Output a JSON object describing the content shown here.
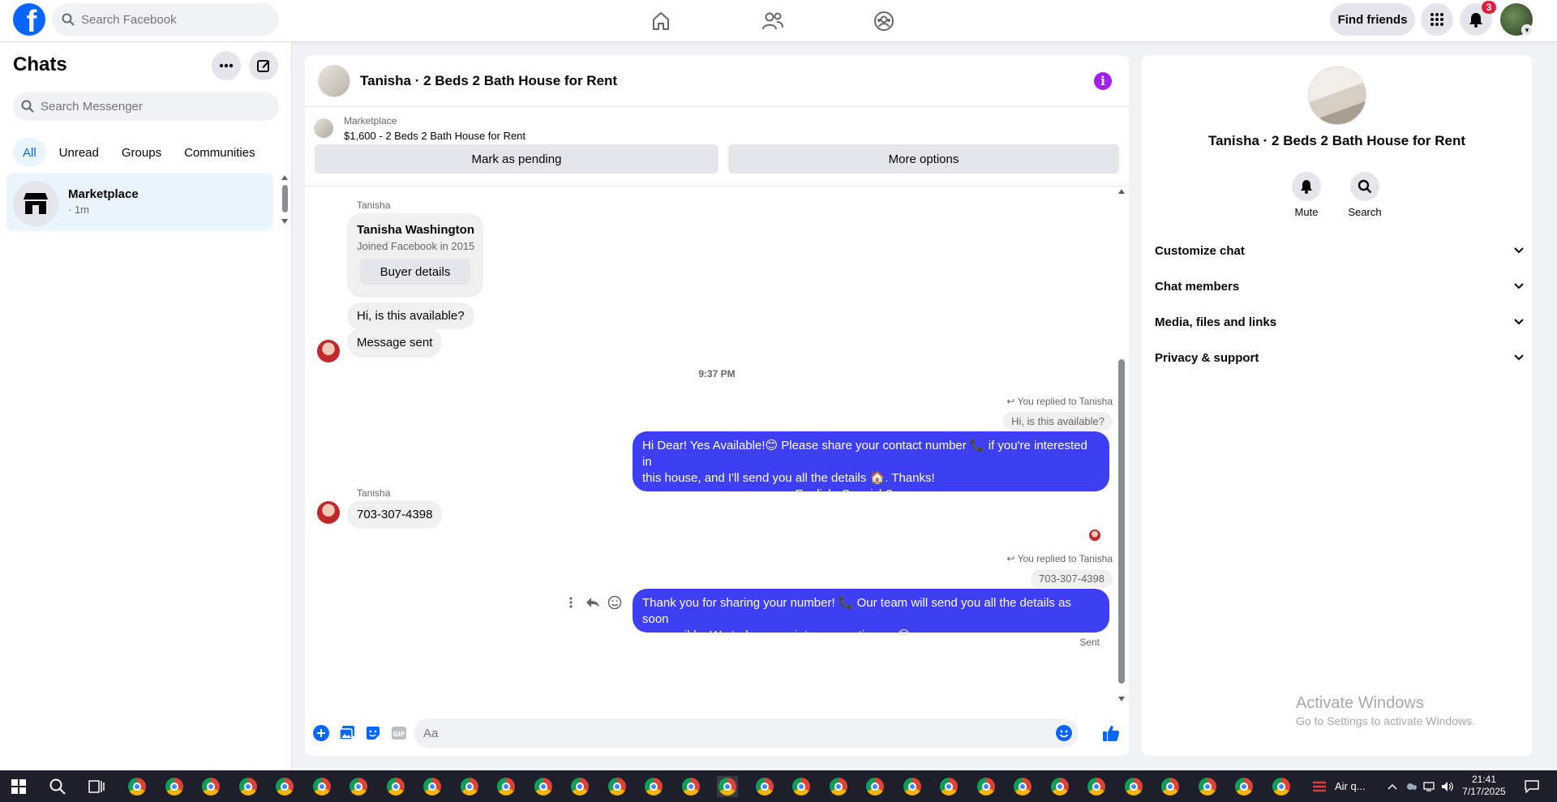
{
  "topbar": {
    "logo": "facebook-logo",
    "search_placeholder": "Search Facebook",
    "nav_icons": [
      "home-icon",
      "friends-icon",
      "groups-icon"
    ],
    "find_friends_label": "Find friends",
    "notifications_count": "3"
  },
  "sidebar": {
    "title": "Chats",
    "search_placeholder": "Search Messenger",
    "tabs": [
      {
        "label": "All",
        "active": true
      },
      {
        "label": "Unread",
        "active": false
      },
      {
        "label": "Groups",
        "active": false
      },
      {
        "label": "Communities",
        "active": false
      }
    ],
    "chats": [
      {
        "name": "Marketplace",
        "sub": "· 1m"
      }
    ]
  },
  "conversation": {
    "title": "Tanisha · 2 Beds 2 Bath House for Rent",
    "marketplace_label": "Marketplace",
    "listing": "$1,600 - 2 Beds 2 Bath House for Rent",
    "mark_pending_label": "Mark as pending",
    "more_options_label": "More options",
    "profile_card": {
      "sender": "Tanisha",
      "name": "Tanisha Washington",
      "joined": "Joined Facebook in 2015",
      "button": "Buyer details"
    },
    "messages": {
      "m1": "Hi, is this available?",
      "m2": "Message sent",
      "time": "9:37 PM",
      "reply_note_1": "You replied to Tanisha",
      "quoted_1": "Hi, is this available?",
      "out1_line1": "Hi Dear! Yes Available!😊 Please share your contact number 📞 if you're interested in",
      "out1_line2": "this house, and I'll send you all the details 🏠. Thanks!",
      "out1_line3": ".    .English,  Spanish?",
      "sender_2": "Tanisha",
      "m3": "703-307-4398",
      "reply_note_2": "You replied to Tanisha",
      "quoted_2": "703-307-4398",
      "out2_line1": "Thank you for sharing your number! 📞 Our team will send you all the details as soon",
      "out2_line2": "as possible. We truly appreciate your patience. 😊",
      "status": "Sent"
    },
    "composer_placeholder": "Aa"
  },
  "rpanel": {
    "title": "Tanisha · 2 Beds 2 Bath House for Rent",
    "mute_label": "Mute",
    "search_label": "Search",
    "rows": [
      "Customize chat",
      "Chat members",
      "Media, files and links",
      "Privacy & support"
    ],
    "watermark_title": "Activate Windows",
    "watermark_sub": "Go to Settings to activate Windows."
  },
  "taskbar": {
    "air_label": "Air q...",
    "time": "21:41",
    "date": "7/17/2025"
  },
  "colors": {
    "brand": "#0866ff",
    "outgoing_bubble": "#3e3ef2",
    "badge": "#e41e3f",
    "info": "#a020f0"
  }
}
